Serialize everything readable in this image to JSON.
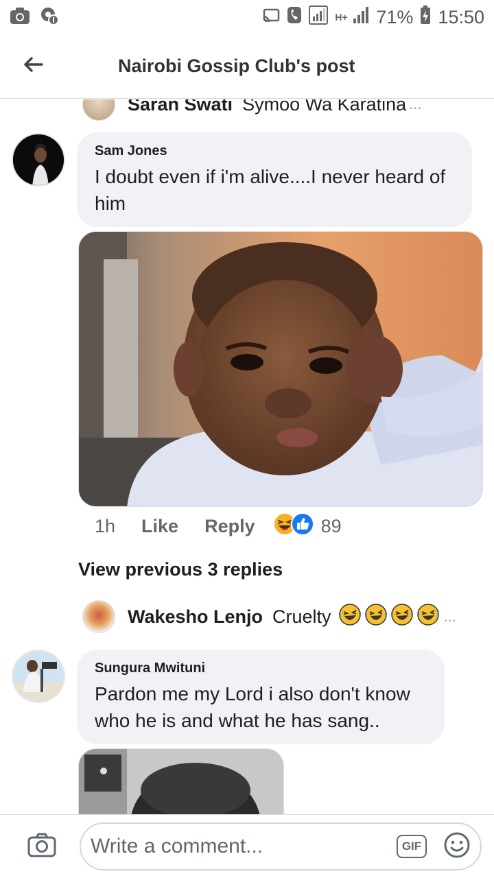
{
  "status_bar": {
    "battery_percent": "71%",
    "time": "15:50",
    "network": "H+"
  },
  "header": {
    "title": "Nairobi Gossip Club's post"
  },
  "top_reply": {
    "name": "Saran Swati",
    "text": "Symoo Wa Karatina",
    "ellipsis": "..."
  },
  "comment1": {
    "name": "Sam Jones",
    "text": "I doubt even if i'm alive....I never heard of him",
    "time": "1h",
    "like_label": "Like",
    "reply_label": "Reply",
    "reaction_count": "89"
  },
  "view_previous": "View previous 3 replies",
  "reply2": {
    "name": "Wakesho Lenjo",
    "text": "Cruelty",
    "ellipsis": "..."
  },
  "comment2": {
    "name": "Sungura Mwituni",
    "text": "Pardon me my Lord  i also don't know who he is and what he has sang.."
  },
  "composer": {
    "placeholder": "Write a comment...",
    "gif_label": "GIF"
  }
}
